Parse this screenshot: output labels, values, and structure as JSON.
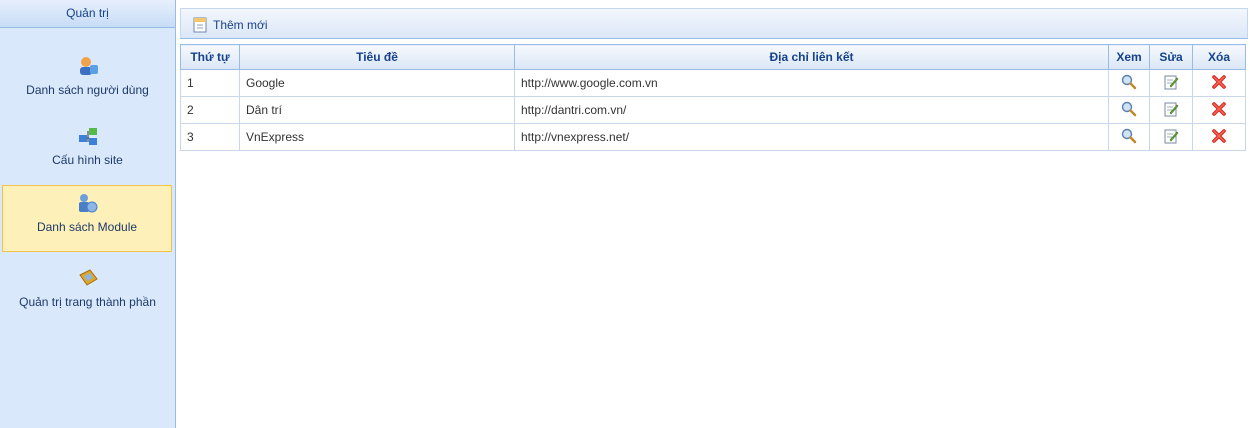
{
  "sidebar": {
    "title": "Quản trị",
    "items": [
      {
        "label": "Danh sách người dùng",
        "icon": "users-icon"
      },
      {
        "label": "Cấu hình site",
        "icon": "site-config-icon"
      },
      {
        "label": "Danh sách Module",
        "icon": "module-icon",
        "active": true
      },
      {
        "label": "Quản trị trang thành phần",
        "icon": "component-page-icon"
      }
    ]
  },
  "toolbar": {
    "add_label": "Thêm mới"
  },
  "grid": {
    "headers": [
      "Thứ tự",
      "Tiêu đề",
      "Địa chỉ liên kết",
      "Xem",
      "Sửa",
      "Xóa"
    ],
    "rows": [
      {
        "order": "1",
        "title": "Google",
        "url": "http://www.google.com.vn"
      },
      {
        "order": "2",
        "title": "Dân trí",
        "url": "http://dantri.com.vn/"
      },
      {
        "order": "3",
        "title": "VnExpress",
        "url": "http://vnexpress.net/"
      }
    ]
  },
  "colors": {
    "accent": "#15428b",
    "sidebar_bg": "#d9e8fb",
    "active_bg": "#fdf0b8",
    "delete": "#d9261c"
  }
}
